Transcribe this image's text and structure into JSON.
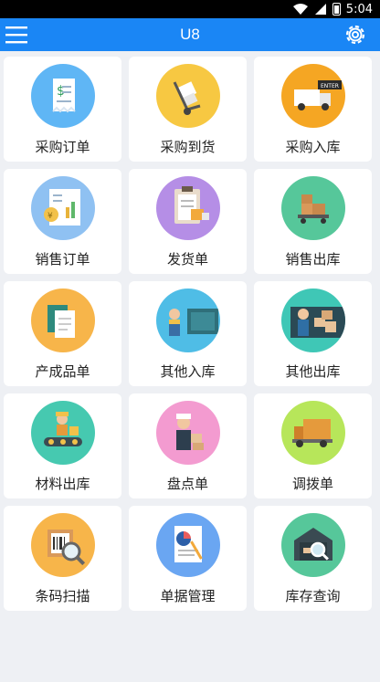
{
  "status": {
    "time": "5:04"
  },
  "header": {
    "title": "U8"
  },
  "tiles": [
    {
      "label": "采购订单",
      "icon": "receipt-icon",
      "color": "#5fb6f5"
    },
    {
      "label": "采购到货",
      "icon": "hand-truck-icon",
      "color": "#f7c842"
    },
    {
      "label": "采购入库",
      "icon": "delivery-truck-icon",
      "color": "#f5a623"
    },
    {
      "label": "销售订单",
      "icon": "sales-chart-icon",
      "color": "#8fc1f2"
    },
    {
      "label": "发货单",
      "icon": "clipboard-icon",
      "color": "#b58ee6"
    },
    {
      "label": "销售出库",
      "icon": "boxes-cart-icon",
      "color": "#56c79a"
    },
    {
      "label": "产成品单",
      "icon": "documents-icon",
      "color": "#f7b54a"
    },
    {
      "label": "其他入库",
      "icon": "worker-truck-icon",
      "color": "#4fbde6"
    },
    {
      "label": "其他出库",
      "icon": "worker-boxes-icon",
      "color": "#3fc7b6"
    },
    {
      "label": "材料出库",
      "icon": "conveyor-worker-icon",
      "color": "#46c9b0"
    },
    {
      "label": "盘点单",
      "icon": "inventory-worker-icon",
      "color": "#f39bd0"
    },
    {
      "label": "调拨单",
      "icon": "cargo-truck-icon",
      "color": "#b7e65a"
    },
    {
      "label": "条码扫描",
      "icon": "barcode-magnifier-icon",
      "color": "#f7b54a"
    },
    {
      "label": "单据管理",
      "icon": "document-report-icon",
      "color": "#6aa6f2"
    },
    {
      "label": "库存查询",
      "icon": "warehouse-search-icon",
      "color": "#56c79a"
    }
  ]
}
